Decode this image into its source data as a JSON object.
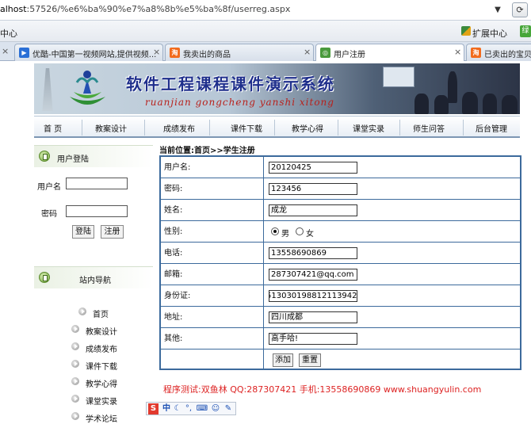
{
  "browser": {
    "address_prefix": "alhost",
    "address_rest": ":57526/%e6%ba%90%e7%a8%8b%e5%ba%8f/userreg.aspx",
    "bookmark_label": "中心",
    "extension_center": "扩展中心",
    "ext_badge": "绿",
    "tabs": [
      {
        "label": "优酷-中国第一视频网站,提供视频...",
        "icon": "youku-icon",
        "color": "#2a6fd6"
      },
      {
        "label": "我卖出的商品",
        "icon": "taobao-icon",
        "color": "#f26b1d"
      },
      {
        "label": "用户注册",
        "icon": "page-icon",
        "color": "#4a9a3c"
      },
      {
        "label": "已卖出的宝贝",
        "icon": "taobao-icon",
        "color": "#f26b1d"
      }
    ]
  },
  "banner": {
    "title": "软件工程课程课件演示系统",
    "subtitle": "ruanjian gongcheng yanshi xitong"
  },
  "nav": {
    "items": [
      "首 页",
      "教案设计",
      "成绩发布",
      "课件下载",
      "教学心得",
      "课堂实录",
      "师生问答",
      "后台管理"
    ]
  },
  "login": {
    "header": "用户登陆",
    "username_label": "用户名",
    "password_label": "密码",
    "username_value": "",
    "password_value": "",
    "login_button": "登陆",
    "register_button": "注册"
  },
  "site_nav": {
    "header": "站内导航",
    "links": [
      "首页",
      "教案设计",
      "成绩发布",
      "课件下载",
      "教学心得",
      "课堂实录",
      "学术论坛"
    ]
  },
  "breadcrumb": "当前位置:首页>>学生注册",
  "form": {
    "fields": [
      {
        "label": "用户名:",
        "value": "20120425"
      },
      {
        "label": "密码:",
        "value": "123456"
      },
      {
        "label": "姓名:",
        "value": "成龙"
      },
      {
        "label": "性别:",
        "value": ""
      },
      {
        "label": "电话:",
        "value": "13558690869"
      },
      {
        "label": "邮箱:",
        "value": "287307421@qq.com"
      },
      {
        "label": "身份证:",
        "value": "513030198812113942"
      },
      {
        "label": "地址:",
        "value": "四川成都"
      },
      {
        "label": "其他:",
        "value": "高手哈!"
      }
    ],
    "gender_male": "男",
    "gender_female": "女",
    "gender_selected": "男",
    "add_button": "添加",
    "reset_button": "重置"
  },
  "footer_credit": "程序测试:双鱼林 QQ:287307421 手机:13558690869 www.shuangyulin.com",
  "ime": {
    "logo": "S",
    "mode": "中"
  }
}
